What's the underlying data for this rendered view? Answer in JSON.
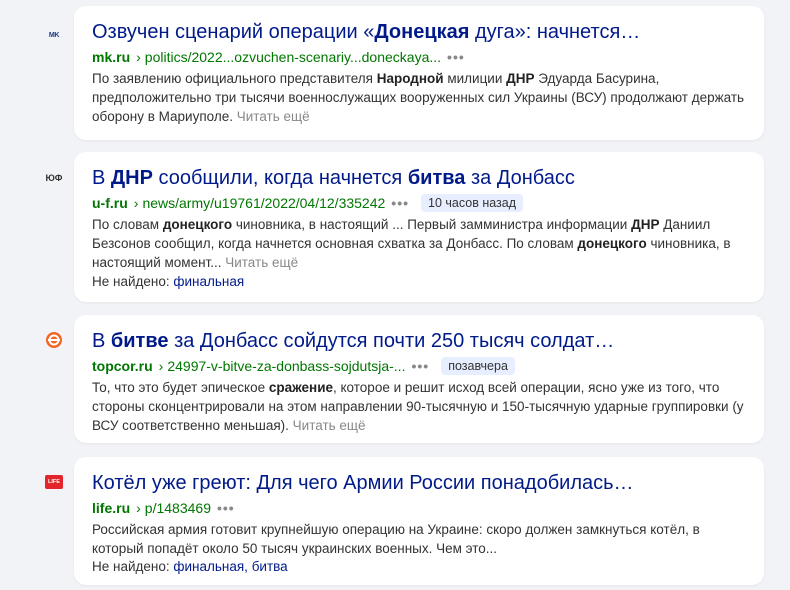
{
  "results": [
    {
      "favicon": "mk-logo",
      "favicon_text": "MK",
      "title_parts": [
        {
          "t": "Озвучен сценарий операции «",
          "b": false
        },
        {
          "t": "Донецкая",
          "b": true
        },
        {
          "t": " дуга»: начнется…",
          "b": false
        }
      ],
      "domain": "mk.ru",
      "path": "politics/2022...ozvuchen-scenariy...doneckaya...",
      "badge": "",
      "snippet_parts": [
        {
          "t": "По заявлению официального представителя ",
          "b": false
        },
        {
          "t": "Народной",
          "b": true
        },
        {
          "t": " милиции ",
          "b": false
        },
        {
          "t": "ДНР",
          "b": true
        },
        {
          "t": " Эдуарда Басурина, предположительно три тысячи военнослужащих вооруженных сил Украины (ВСУ) продолжают держать оборону в Мариуполе.",
          "b": false
        }
      ],
      "read_more": "Читать ещё",
      "missing_label": "",
      "missing_terms": ""
    },
    {
      "favicon": "uf-logo",
      "favicon_text": "ЮФ",
      "title_parts": [
        {
          "t": "В ",
          "b": false
        },
        {
          "t": "ДНР",
          "b": true
        },
        {
          "t": " сообщили, когда начнется ",
          "b": false
        },
        {
          "t": "битва",
          "b": true
        },
        {
          "t": " за Донбасс",
          "b": false
        }
      ],
      "domain": "u-f.ru",
      "path": "news/army/u19761/2022/04/12/335242",
      "badge": "10 часов назад",
      "snippet_parts": [
        {
          "t": "По словам ",
          "b": false
        },
        {
          "t": "донецкого",
          "b": true
        },
        {
          "t": " чиновника, в настоящий ... Первый замминистра информации ",
          "b": false
        },
        {
          "t": "ДНР",
          "b": true
        },
        {
          "t": " Даниил Безсонов сообщил, когда начнется основная схватка за Донбасс. По словам ",
          "b": false
        },
        {
          "t": "донецкого",
          "b": true
        },
        {
          "t": " чиновника, в настоящий момент...",
          "b": false
        }
      ],
      "read_more": "Читать ещё",
      "missing_label": "Не найдено:",
      "missing_terms": "финальная"
    },
    {
      "favicon": "topcor-logo",
      "favicon_text": "",
      "title_parts": [
        {
          "t": "В ",
          "b": false
        },
        {
          "t": "битве",
          "b": true
        },
        {
          "t": " за Донбасс сойдутся почти 250 тысяч солдат…",
          "b": false
        }
      ],
      "domain": "topcor.ru",
      "path": "24997-v-bitve-za-donbass-sojdutsja-...",
      "badge": "позавчера",
      "snippet_parts": [
        {
          "t": "То, что это будет эпическое ",
          "b": false
        },
        {
          "t": "сражение",
          "b": true
        },
        {
          "t": ", которое и решит исход всей операции, ясно уже из того, что стороны сконцентрировали на этом направлении 90-тысячную и 150-тысячную ударные группировки (у ВСУ соответственно меньшая).",
          "b": false
        }
      ],
      "read_more": "Читать ещё",
      "missing_label": "",
      "missing_terms": ""
    },
    {
      "favicon": "life-logo",
      "favicon_text": "LIFE",
      "title_parts": [
        {
          "t": "Котёл уже греют: Для чего Армии России понадобилась…",
          "b": false
        }
      ],
      "domain": "life.ru",
      "path": "p/1483469",
      "badge": "",
      "snippet_parts": [
        {
          "t": "Российская армия готовит крупнейшую операцию на Украине: скоро должен замкнуться котёл, в который попадёт около 50 тысяч украинских военных. Чем это...",
          "b": false
        }
      ],
      "read_more": "",
      "missing_label": "Не найдено:",
      "missing_terms": "финальная, битва"
    }
  ],
  "colors": {
    "title": "#001a8a",
    "url": "#007700",
    "badge_bg": "#e6eeff",
    "topcor": "#f26522",
    "life": "#e3242b"
  }
}
